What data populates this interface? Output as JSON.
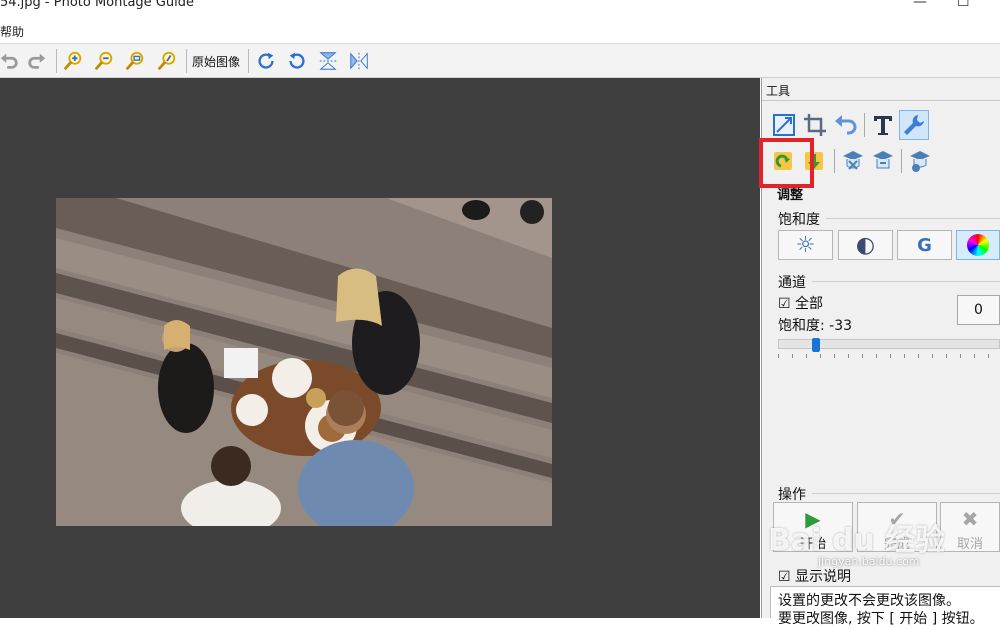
{
  "window": {
    "title": "54.jpg - Photo Montage Guide",
    "controls": [
      "—",
      "☐"
    ]
  },
  "menubar": {
    "items": [
      "帮助"
    ]
  },
  "toolbar": {
    "original_image_label": "原始图像",
    "buttons": [
      "undo-icon",
      "redo-icon",
      "zoom-in-icon",
      "zoom-out-icon",
      "zoom-fit-icon",
      "zoom-actual-icon",
      "rotate-cw-icon",
      "rotate-ccw-icon",
      "flip-vertical-icon",
      "flip-horizontal-icon"
    ]
  },
  "tools_panel": {
    "header": "工具",
    "row1_tools": [
      "resize-icon",
      "crop-icon",
      "undo-arrow-icon",
      "text-T-icon",
      "wrench-icon"
    ],
    "row2_tools": [
      "load-settings-icon",
      "save-settings-icon",
      "hat-x-icon",
      "hat-clear-icon",
      "hat-gear-icon"
    ],
    "adjust_title": "调整",
    "saturation_group": {
      "title": "饱和度",
      "buttons": [
        {
          "icon": "brightness-icon",
          "glyph": "☼"
        },
        {
          "icon": "contrast-icon",
          "glyph": "◐"
        },
        {
          "icon": "gamma-icon",
          "glyph": "G"
        },
        {
          "icon": "color-wheel-icon",
          "glyph": ""
        }
      ]
    },
    "channel_group": {
      "title": "通道",
      "all_label": "☑ 全部",
      "saturation_label": "饱和度: -33",
      "value": "0",
      "slider_fraction": 0.17
    },
    "operations": {
      "title": "操作",
      "start": {
        "label": "开始",
        "glyph": "▶"
      },
      "done": {
        "label": "完成",
        "glyph": "✔"
      },
      "cancel": {
        "label": "取消",
        "glyph": "✖"
      }
    },
    "show_help_label": "☑ 显示说明",
    "help_line1": "设置的更改不会更改该图像。",
    "help_line2": "要更改图像, 按下 [ 开始 ] 按钮。"
  },
  "watermark": {
    "main": "Bai du 经验",
    "sub": "jingyan.baidu.com"
  },
  "colors": {
    "canvas_bg": "#3f3f3f",
    "highlight": "#e0242a",
    "accent": "#1a73d6"
  }
}
